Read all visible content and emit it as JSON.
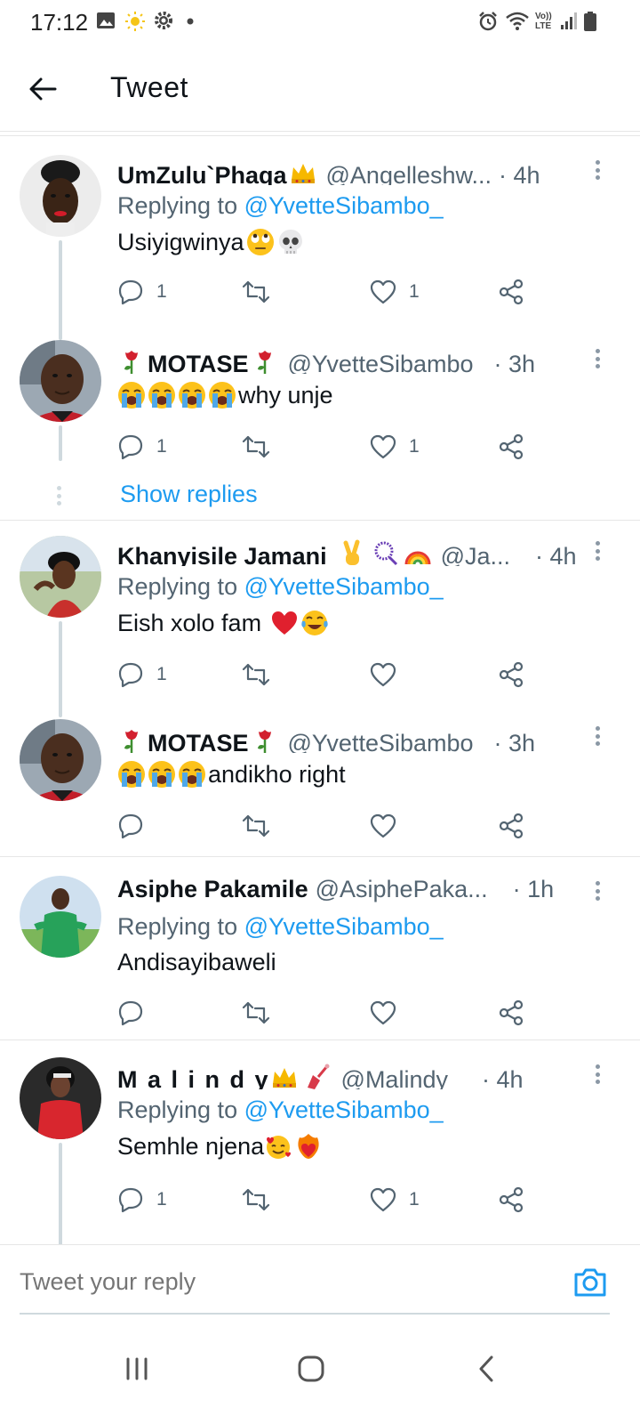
{
  "status_bar": {
    "time": "17:12",
    "network_label": "Vo)) LTE"
  },
  "header": {
    "title": "Tweet",
    "back_icon": "arrow-left-icon"
  },
  "tweets": [
    {
      "name": "UmZulu`Phaqa",
      "handle": "@Angelleshw...",
      "time": "· 4h",
      "replying_label": "Replying to ",
      "replying_to": "@YvetteSibambo_",
      "text": "Usiyigwinya",
      "emojis": [
        "face-with-rolling-eyes",
        "skull"
      ],
      "replies": "1",
      "retweets": "",
      "likes": "1"
    },
    {
      "name": "MOTASE",
      "handle": "@YvetteSibambo_",
      "time": "· 3h",
      "text": "why unje",
      "emojis": [
        "loudly-crying-face",
        "loudly-crying-face",
        "loudly-crying-face",
        "loudly-crying-face"
      ],
      "replies": "1",
      "retweets": "",
      "likes": "1",
      "show_replies": "Show replies"
    },
    {
      "name": "Khanyisile Jamani",
      "handle": "@Ja...",
      "time": "· 4h",
      "replying_label": "Replying to ",
      "replying_to": "@YvetteSibambo_",
      "text": "Eish xolo fam",
      "emojis": [
        "red-heart",
        "face-with-tears-of-joy"
      ],
      "replies": "1",
      "retweets": "",
      "likes": ""
    },
    {
      "name": "MOTASE",
      "handle": "@YvetteSibambo_",
      "time": "· 3h",
      "text": "andikho right",
      "emojis": [
        "loudly-crying-face",
        "loudly-crying-face",
        "loudly-crying-face"
      ],
      "replies": "",
      "retweets": "",
      "likes": ""
    },
    {
      "name": "Asiphe Pakamile",
      "handle": "@AsiphePaka...",
      "time": "· 1h",
      "replying_label": "Replying to ",
      "replying_to": "@YvetteSibambo_",
      "text": "Andisayibaweli",
      "replies": "",
      "retweets": "",
      "likes": ""
    },
    {
      "name": "M a l i n d y",
      "handle": "@Malindy__",
      "time": "· 4h",
      "replying_label": "Replying to ",
      "replying_to": "@YvetteSibambo_",
      "text": "Semhle njena",
      "emojis": [
        "smiling-face-with-hearts",
        "heart-on-fire"
      ],
      "replies": "1",
      "retweets": "",
      "likes": "1"
    }
  ],
  "compose": {
    "placeholder": "Tweet your reply",
    "camera_icon": "camera-icon"
  },
  "navbar": {
    "recents_icon": "recents-icon",
    "home_icon": "home-icon",
    "back_icon": "nav-back-icon"
  },
  "colors": {
    "accent": "#1d9bf0",
    "text": "#0f1419",
    "muted": "#536471",
    "border": "#e6e6e6"
  }
}
